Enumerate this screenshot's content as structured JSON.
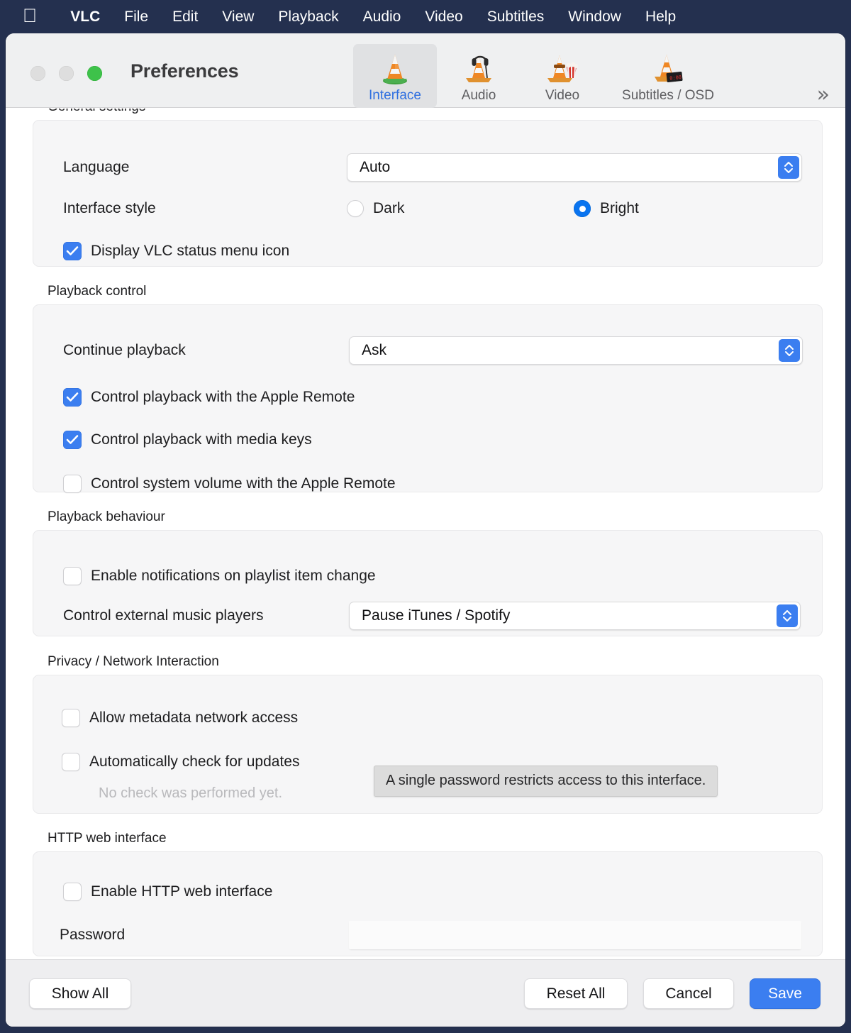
{
  "menubar": {
    "apple_icon": "apple-logo",
    "items": [
      {
        "label": "VLC",
        "bold": true
      },
      {
        "label": "File",
        "bold": false
      },
      {
        "label": "Edit",
        "bold": false
      },
      {
        "label": "View",
        "bold": false
      },
      {
        "label": "Playback",
        "bold": false
      },
      {
        "label": "Audio",
        "bold": false
      },
      {
        "label": "Video",
        "bold": false
      },
      {
        "label": "Subtitles",
        "bold": false
      },
      {
        "label": "Window",
        "bold": false
      },
      {
        "label": "Help",
        "bold": false
      }
    ]
  },
  "window": {
    "title": "Preferences",
    "traffic_lights": {
      "close": "close-button",
      "minimize": "minimize-button",
      "zoom": "zoom-button"
    },
    "overflow_label": "»"
  },
  "toolbar": {
    "tabs": [
      {
        "label": "Interface",
        "icon": "vlc-cone-icon",
        "selected": true
      },
      {
        "label": "Audio",
        "icon": "vlc-cone-headphones-icon",
        "selected": false
      },
      {
        "label": "Video",
        "icon": "vlc-cone-popcorn-icon",
        "selected": false
      },
      {
        "label": "Subtitles / OSD",
        "icon": "vlc-cone-clapper-icon",
        "selected": false
      }
    ]
  },
  "sections": {
    "general": {
      "title": "General settings",
      "language_label": "Language",
      "language_value": "Auto",
      "interface_style_label": "Interface style",
      "style_dark_label": "Dark",
      "style_bright_label": "Bright",
      "style_selected": "Bright",
      "status_menu_label": "Display VLC status menu icon",
      "status_menu_checked": true
    },
    "playback_control": {
      "title": "Playback control",
      "continue_label": "Continue playback",
      "continue_value": "Ask",
      "apple_remote_label": "Control playback with the Apple Remote",
      "apple_remote_checked": true,
      "media_keys_label": "Control playback with media keys",
      "media_keys_checked": true,
      "system_volume_label": "Control system volume with the Apple Remote",
      "system_volume_checked": false
    },
    "playback_behaviour": {
      "title": "Playback behaviour",
      "notifications_label": "Enable notifications on playlist item change",
      "notifications_checked": false,
      "external_players_label": "Control external music players",
      "external_players_value": "Pause iTunes / Spotify"
    },
    "privacy": {
      "title": "Privacy / Network Interaction",
      "metadata_label": "Allow metadata network access",
      "metadata_checked": false,
      "updates_label": "Automatically check for updates",
      "updates_checked": false,
      "update_status": "No check was performed yet."
    },
    "http": {
      "title": "HTTP web interface",
      "enable_label": "Enable HTTP web interface",
      "enable_checked": false,
      "password_label": "Password",
      "password_value": "",
      "password_placeholder": ""
    }
  },
  "tooltip": {
    "text": "A single password restricts access to this interface."
  },
  "buttons": {
    "show_all": "Show All",
    "reset_all": "Reset All",
    "cancel": "Cancel",
    "save": "Save"
  },
  "colors": {
    "menubar_bg": "#24304f",
    "accent_blue": "#3b7ef0",
    "radio_blue": "#0a74ef",
    "tab_selected_text": "#2f6fe0",
    "zoom_green": "#3ec24a",
    "tooltip_bg": "#dcdcdc"
  }
}
